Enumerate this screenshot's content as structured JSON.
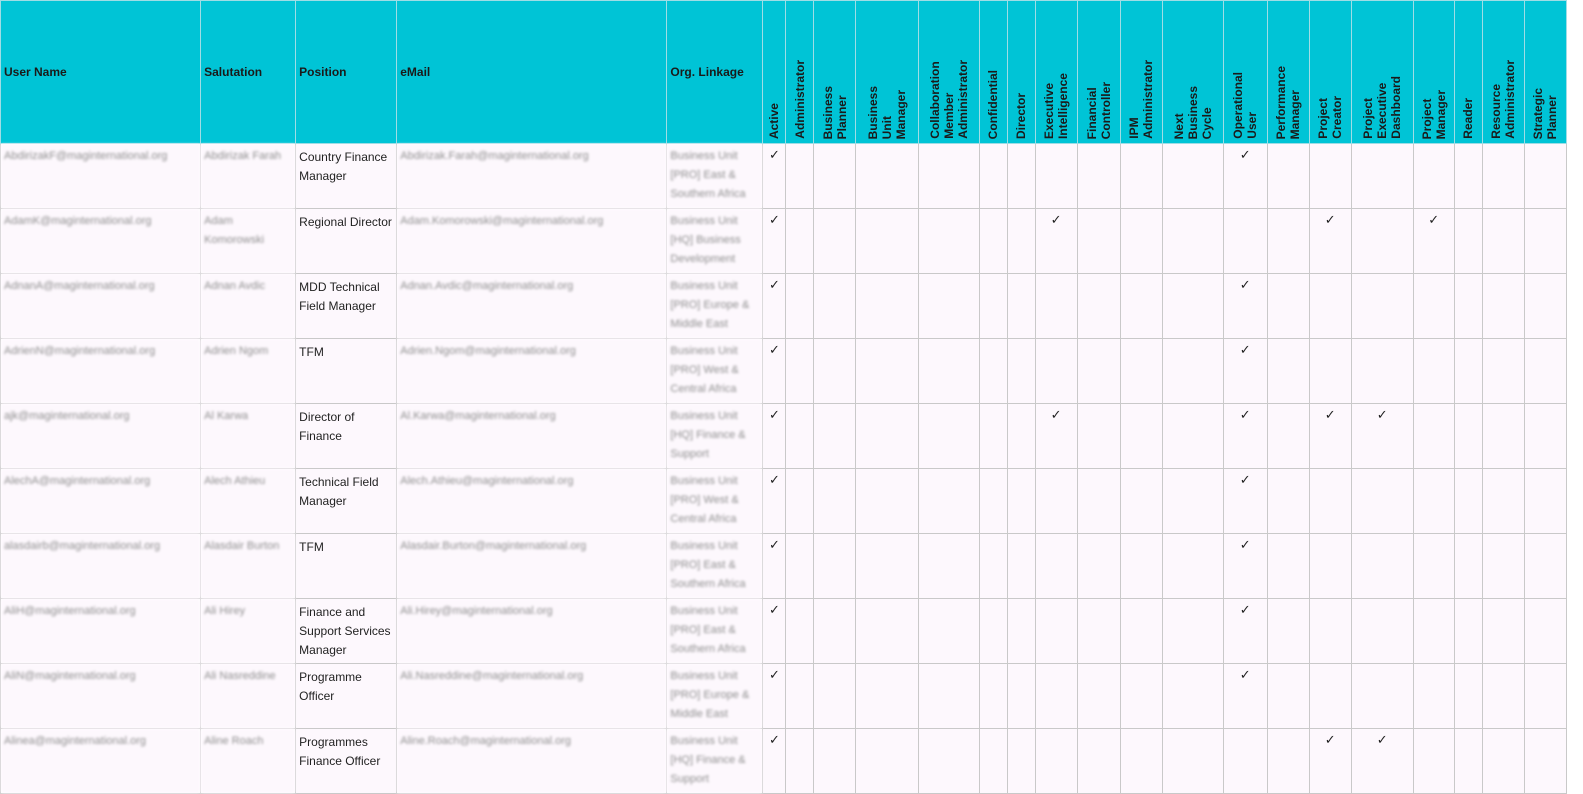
{
  "headers": {
    "user_name": "User Name",
    "salutation": "Salutation",
    "position": "Position",
    "email": "eMail",
    "org_linkage": "Org. Linkage"
  },
  "roles": [
    "Active",
    "Administrator",
    "Business\nPlanner",
    "Business\nUnit\nManager",
    "Collaboration\nMember\nAdministrator",
    "Confidential",
    "Director",
    "Executive\nIntelligence",
    "Financial\nController",
    "IPM\nAdministrator",
    "Next\nBusiness\nCycle",
    "Operational\nUser",
    "Performance\nManager",
    "Project\nCreator",
    "Project\nExecutive\nDashboard",
    "Project\nManager",
    "Reader",
    "Resource\nAdministrator",
    "Strategic\nPlanner"
  ],
  "check_symbol": "✓",
  "rows": [
    {
      "user": "AbdirizakF@maginternational.org",
      "salutation": "Abdirizak Farah",
      "position": "Country Finance Manager",
      "email": "Abdirizak.Farah@maginternational.org",
      "org": "Business Unit [PRO] East & Southern Africa",
      "checks": [
        0,
        11
      ]
    },
    {
      "user": "AdamK@maginternational.org",
      "salutation": "Adam Komorowski",
      "position": "Regional Director",
      "email": "Adam.Komorowski@maginternational.org",
      "org": "Business Unit [HQ] Business Development",
      "checks": [
        0,
        7,
        13,
        15
      ]
    },
    {
      "user": "AdnanA@maginternational.org",
      "salutation": "Adnan Avdic",
      "position": "MDD Technical Field Manager",
      "email": "Adnan.Avdic@maginternational.org",
      "org": "Business Unit [PRO] Europe & Middle East",
      "checks": [
        0,
        11
      ]
    },
    {
      "user": "AdrienN@maginternational.org",
      "salutation": "Adrien Ngom",
      "position": "TFM",
      "email": "Adrien.Ngom@maginternational.org",
      "org": "Business Unit [PRO] West & Central Africa",
      "checks": [
        0,
        11
      ]
    },
    {
      "user": "ajk@maginternational.org",
      "salutation": "Al Karwa",
      "position": "Director of Finance",
      "email": "Al.Karwa@maginternational.org",
      "org": "Business Unit [HQ] Finance & Support",
      "checks": [
        0,
        7,
        11,
        13,
        14
      ]
    },
    {
      "user": "AlechA@maginternational.org",
      "salutation": "Alech Athieu",
      "position": "Technical Field Manager",
      "email": "Alech.Athieu@maginternational.org",
      "org": "Business Unit [PRO] West & Central Africa",
      "checks": [
        0,
        11
      ]
    },
    {
      "user": "alasdairb@maginternational.org",
      "salutation": "Alasdair Burton",
      "position": "TFM",
      "email": "Alasdair.Burton@maginternational.org",
      "org": "Business Unit [PRO] East & Southern Africa",
      "checks": [
        0,
        11
      ]
    },
    {
      "user": "AliH@maginternational.org",
      "salutation": "Ali Hirey",
      "position": "Finance and Support Services Manager",
      "email": "Ali.Hirey@maginternational.org",
      "org": "Business Unit [PRO] East & Southern Africa",
      "checks": [
        0,
        11
      ]
    },
    {
      "user": "AliN@maginternational.org",
      "salutation": "Ali Nasreddine",
      "position": "Programme Officer",
      "email": "Ali.Nasreddine@maginternational.org",
      "org": "Business Unit [PRO] Europe & Middle East",
      "checks": [
        0,
        11
      ]
    },
    {
      "user": "Alinea@maginternational.org",
      "salutation": "Aline Roach",
      "position": "Programmes Finance Officer",
      "email": "Aline.Roach@maginternational.org",
      "org": "Business Unit [HQ] Finance & Support",
      "checks": [
        0,
        13,
        14
      ]
    }
  ]
}
